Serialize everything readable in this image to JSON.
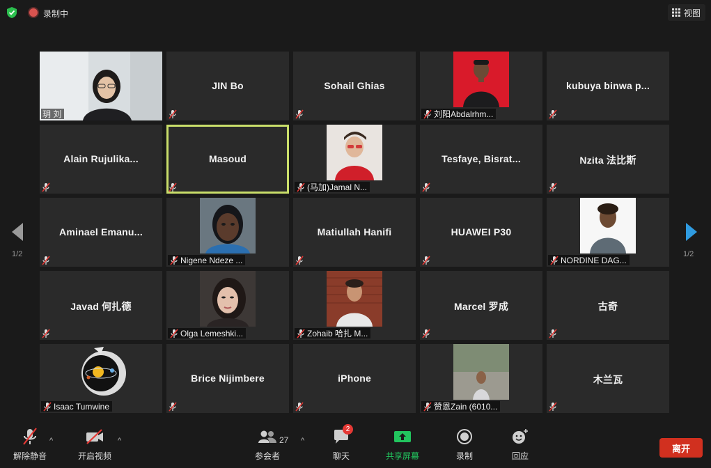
{
  "top": {
    "recording_label": "录制中",
    "view_label": "视图"
  },
  "colors": {
    "active_speaker_border": "#c9de6a",
    "tile_bg": "#2a2a2a",
    "leave_bg": "#d1301f",
    "share_green": "#22c55e"
  },
  "nav": {
    "left_page": "1/2",
    "right_page": "1/2"
  },
  "tiles": [
    {
      "label": "玥 刘",
      "name": "",
      "photo": "video-woman"
    },
    {
      "label": "",
      "name": "JIN Bo"
    },
    {
      "label": "",
      "name": "Sohail Ghias"
    },
    {
      "label": "刘阳Abdalrhm...",
      "name": "",
      "photo": "man-red"
    },
    {
      "label": "",
      "name": "kubuya  binwa  p..."
    },
    {
      "label": "",
      "name": "Alain  Rujulika..."
    },
    {
      "label": "",
      "name": "Masoud",
      "active": true
    },
    {
      "label": "(马加)Jamal N...",
      "name": "",
      "photo": "man-cap"
    },
    {
      "label": "",
      "name": "Tesfaye,  Bisrat..."
    },
    {
      "label": "",
      "name": "Nzita  法比斯"
    },
    {
      "label": "",
      "name": "Aminael  Emanu..."
    },
    {
      "label": "Nigene Ndeze ...",
      "name": "",
      "photo": "woman-selfie"
    },
    {
      "label": "",
      "name": "Matiullah Hanifi"
    },
    {
      "label": "",
      "name": "HUAWEI P30"
    },
    {
      "label": "NORDINE DAG...",
      "name": "",
      "photo": "man-white"
    },
    {
      "label": "",
      "name": "Javad  何扎德"
    },
    {
      "label": "Olga Lemeshki...",
      "name": "",
      "photo": "woman-dark"
    },
    {
      "label": "Zohaib 哈扎 M...",
      "name": "",
      "photo": "man-brick"
    },
    {
      "label": "",
      "name": "Marcel 罗成"
    },
    {
      "label": "",
      "name": "古奇"
    },
    {
      "label": "Isaac Tumwine",
      "name": "",
      "photo": "cartoon"
    },
    {
      "label": "",
      "name": "Brice Nijimbere"
    },
    {
      "label": "",
      "name": "iPhone"
    },
    {
      "label": "赞恩Zain (6010...",
      "name": "",
      "photo": "man-street"
    },
    {
      "label": "",
      "name": "木兰瓦"
    }
  ],
  "toolbar": {
    "unmute": "解除静音",
    "start_video": "开启视频",
    "participants": "参会者",
    "participant_count": "27",
    "chat": "聊天",
    "chat_badge": "2",
    "share": "共享屏幕",
    "record": "录制",
    "reactions": "回应",
    "leave": "离开"
  }
}
